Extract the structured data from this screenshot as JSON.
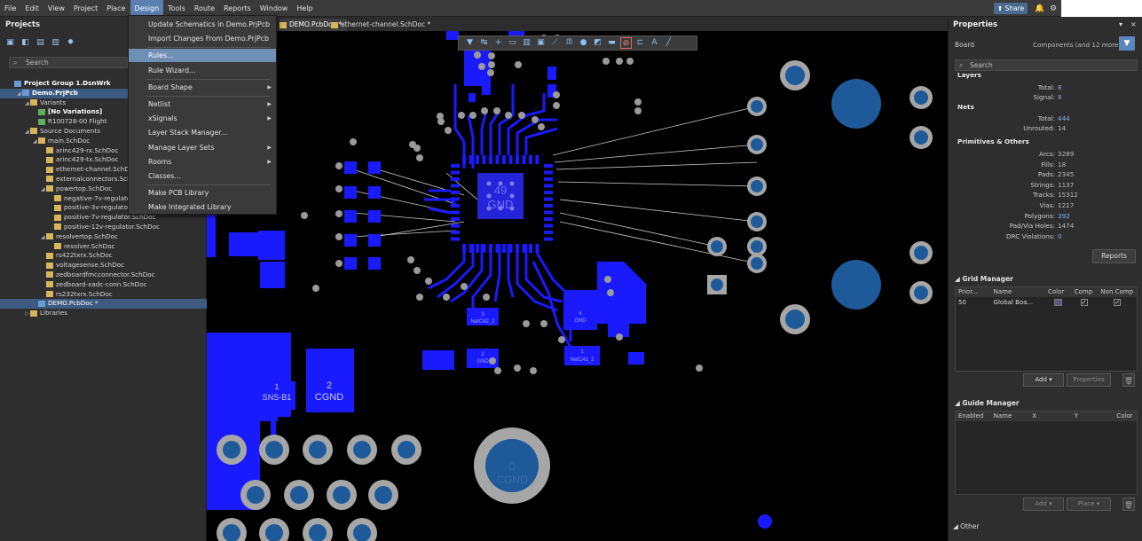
{
  "menubar": {
    "items": [
      "File",
      "Edit",
      "View",
      "Project",
      "Place",
      "Design",
      "Tools",
      "Route",
      "Reports",
      "Window",
      "Help"
    ],
    "active_index": 5,
    "share_label": "Share"
  },
  "projects_panel": {
    "title": "Projects",
    "search_placeholder": "Search",
    "tree": [
      {
        "label": "Project Group 1.DsnWrk",
        "indent": 0,
        "type": "proj",
        "arrow": "",
        "bold": true
      },
      {
        "label": "Demo.PrjPcb",
        "indent": 1,
        "type": "proj",
        "arrow": "◢",
        "bold": true,
        "selected": true
      },
      {
        "label": "Variants",
        "indent": 2,
        "type": "folder",
        "arrow": "◢"
      },
      {
        "label": "[No Variations]",
        "indent": 3,
        "type": "var",
        "arrow": "",
        "bold": true
      },
      {
        "label": "R100728-00 Flight",
        "indent": 3,
        "type": "var",
        "arrow": ""
      },
      {
        "label": "Source Documents",
        "indent": 2,
        "type": "folder",
        "arrow": "◢"
      },
      {
        "label": "main.SchDoc",
        "indent": 3,
        "type": "folder",
        "arrow": "◢"
      },
      {
        "label": "arinc429-rx.SchDoc",
        "indent": 4,
        "type": "doc",
        "arrow": ""
      },
      {
        "label": "arinc429-tx.SchDoc",
        "indent": 4,
        "type": "doc",
        "arrow": ""
      },
      {
        "label": "ethernet-channel.SchDoc",
        "indent": 4,
        "type": "doc",
        "arrow": ""
      },
      {
        "label": "externalconnectors.SchDoc",
        "indent": 4,
        "type": "doc",
        "arrow": ""
      },
      {
        "label": "powertop.SchDoc",
        "indent": 4,
        "type": "doc",
        "arrow": "◢"
      },
      {
        "label": "negative-7v-regulator.SchDoc",
        "indent": 5,
        "type": "doc",
        "arrow": ""
      },
      {
        "label": "positive-3v-regulator.SchDoc",
        "indent": 5,
        "type": "doc",
        "arrow": ""
      },
      {
        "label": "positive-7v-regulator.SchDoc",
        "indent": 5,
        "type": "doc",
        "arrow": ""
      },
      {
        "label": "positive-12v-regulator.SchDoc",
        "indent": 5,
        "type": "doc",
        "arrow": ""
      },
      {
        "label": "resolvertop.SchDoc",
        "indent": 4,
        "type": "doc",
        "arrow": "◢"
      },
      {
        "label": "resolver.SchDoc",
        "indent": 5,
        "type": "doc",
        "arrow": ""
      },
      {
        "label": "rs422txrx.SchDoc",
        "indent": 4,
        "type": "doc",
        "arrow": ""
      },
      {
        "label": "voltagesense.SchDoc",
        "indent": 4,
        "type": "doc",
        "arrow": ""
      },
      {
        "label": "zedboardfmcconnector.SchDoc",
        "indent": 4,
        "type": "doc",
        "arrow": ""
      },
      {
        "label": "zedboard-xadc-conn.SchDoc",
        "indent": 4,
        "type": "doc",
        "arrow": ""
      },
      {
        "label": "rs232txrx.SchDoc",
        "indent": 4,
        "type": "doc",
        "arrow": ""
      },
      {
        "label": "DEMO.PcbDoc *",
        "indent": 3,
        "type": "pcb",
        "arrow": "",
        "selected": true
      },
      {
        "label": "Libraries",
        "indent": 2,
        "type": "folder",
        "arrow": "▷"
      }
    ]
  },
  "tabs": [
    {
      "label": "DEMO.PcbDoc *",
      "active": true
    },
    {
      "label": "ethernet-channel.SchDoc *",
      "active": false
    }
  ],
  "design_menu": {
    "items": [
      {
        "label": "Update Schematics in Demo.PrjPcb",
        "sub": false
      },
      {
        "label": "Import Changes From Demo.PrjPcb",
        "sub": false
      },
      {
        "sep": true
      },
      {
        "label": "Rules...",
        "sub": false,
        "hover": true
      },
      {
        "label": "Rule Wizard...",
        "sub": false
      },
      {
        "sep": true
      },
      {
        "label": "Board Shape",
        "sub": true
      },
      {
        "sep": true
      },
      {
        "label": "Netlist",
        "sub": true
      },
      {
        "label": "xSignals",
        "sub": true
      },
      {
        "label": "Layer Stack Manager...",
        "sub": false
      },
      {
        "label": "Manage Layer Sets",
        "sub": true
      },
      {
        "label": "Rooms",
        "sub": true
      },
      {
        "label": "Classes...",
        "sub": false
      },
      {
        "sep": true
      },
      {
        "label": "Make PCB Library",
        "sub": false
      },
      {
        "label": "Make Integrated Library",
        "sub": false
      }
    ]
  },
  "pcb": {
    "center_pad_number": "49",
    "center_pad_net": "GND",
    "labels": [
      {
        "num": "1",
        "net": "SNS-B1"
      },
      {
        "num": "2",
        "net": "CGND"
      },
      {
        "num": "0",
        "net": "CGND"
      },
      {
        "num": "3",
        "net": "NetC42_2"
      },
      {
        "num": "2",
        "net": "GND"
      },
      {
        "num": "4",
        "net": "GND"
      },
      {
        "num": "1",
        "net": "NetC41_2"
      }
    ],
    "colors": {
      "copper": "#1a1aff",
      "copper_dark": "#2424d8",
      "via": "#9a9a9a",
      "background": "#000000",
      "ratsnest": "#c8c8c8",
      "pad_ring": "#a6a6a6",
      "pad_hole": "#1e5a9a"
    }
  },
  "properties_panel": {
    "title": "Properties",
    "board_label": "Board",
    "components_label": "Components (and 12 more)",
    "search_placeholder": "Search",
    "layers_title": "Layers",
    "layers": [
      {
        "k": "Total:",
        "v": "8"
      },
      {
        "k": "Signal:",
        "v": "8"
      }
    ],
    "nets_title": "Nets",
    "nets": [
      {
        "k": "Total:",
        "v": "444"
      },
      {
        "k": "Unrouted:",
        "v": "14"
      }
    ],
    "primitives_title": "Primitives & Others",
    "primitives": [
      {
        "k": "Arcs:",
        "v": "3289"
      },
      {
        "k": "Fills:",
        "v": "18"
      },
      {
        "k": "Pads:",
        "v": "2345"
      },
      {
        "k": "Strings:",
        "v": "1137"
      },
      {
        "k": "Tracks:",
        "v": "15312"
      },
      {
        "k": "Vias:",
        "v": "1217"
      },
      {
        "k": "Polygons:",
        "v": "392"
      },
      {
        "k": "Pad/Via Holes:",
        "v": "1474"
      },
      {
        "k": "DRC Violations:",
        "v": "0"
      }
    ],
    "reports_label": "Reports",
    "grid_manager": {
      "title": "Grid Manager",
      "headers": [
        "Prior...",
        "Name",
        "Color",
        "Comp",
        "Non Comp"
      ],
      "rows": [
        {
          "priority": "50",
          "name": "Global Boa..."
        }
      ],
      "add_label": "Add",
      "properties_label": "Properties"
    },
    "guide_manager": {
      "title": "Guide Manager",
      "headers": [
        "Enabled",
        "Name",
        "X",
        "Y",
        "Color"
      ],
      "add_label": "Add",
      "place_label": "Place"
    },
    "other_label": "Other"
  }
}
